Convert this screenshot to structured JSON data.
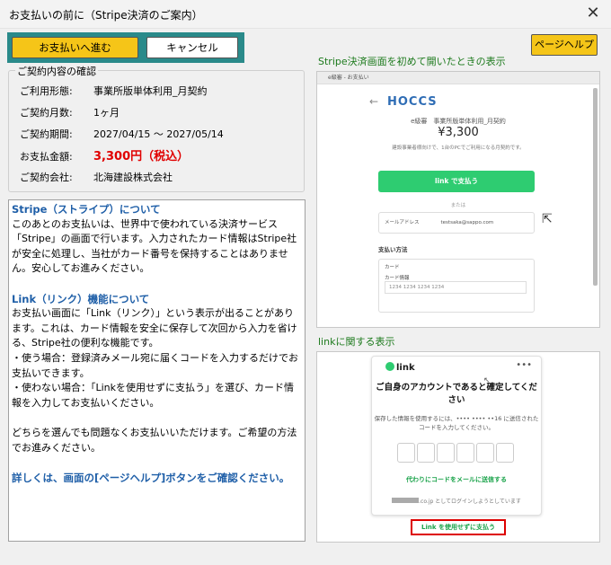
{
  "window": {
    "title": "お支払いの前に（Stripe決済のご案内）",
    "close_label": "✕"
  },
  "toolbar": {
    "proceed_label": "お支払いへ進む",
    "cancel_label": "キャンセル",
    "help_label": "ページヘルプ"
  },
  "contract": {
    "legend": "ご契約内容の確認",
    "rows": [
      {
        "label": "ご利用形態:",
        "value": "事業所版単体利用_月契約"
      },
      {
        "label": "ご契約月数:",
        "value": "1ヶ月"
      },
      {
        "label": "ご契約期間:",
        "value": "2027/04/15 ～ 2027/05/14"
      },
      {
        "label": "お支払金額:",
        "value": "3,300円（税込）"
      },
      {
        "label": "ご契約会社:",
        "value": "北海建設株式会社"
      }
    ]
  },
  "info": {
    "heading1": "Stripe（ストライプ）について",
    "para1": "このあとのお支払いは、世界中で使われている決済サービス「Stripe」の画面で行います。入力されたカード情報はStripe社が安全に処理し、当社がカード番号を保持することはありません。安心してお進みください。",
    "heading2": "Link（リンク）機能について",
    "para2": "お支払い画面に「Link（リンク）」という表示が出ることがあります。これは、カード情報を安全に保存して次回から入力を省ける、Stripe社の便利な機能です。",
    "bullet1": "・使う場合：登録済みメール宛に届くコードを入力するだけでお支払いできます。",
    "bullet2": "・使わない場合：「Linkを使用せずに支払う」を選び、カード情報を入力してお支払いください。",
    "para3": "どちらを選んでも問題なくお支払いいただけます。ご希望の方法でお進みください。",
    "footer": "詳しくは、画面の[ページヘルプ]ボタンをご確認ください。"
  },
  "stripe_preview": {
    "label": "Stripe決済画面を初めて開いたときの表示",
    "tab_text": "e級審 - お支払い",
    "logo": "HOCCS",
    "product": "e級審　事業所版単体利用_月契約",
    "price": "¥3,300",
    "note": "建設事業者様向けで、1台のPCでご利用になる月契約です。",
    "link_button": "link で支払う",
    "or_text": "または",
    "email_label": "メールアドレス",
    "email_value": "testsaka@sappo.com",
    "payment_method": "支払い方法",
    "card_label": "カード",
    "card_info_label": "カード情報",
    "card_number_placeholder": "1234 1234 1234 1234"
  },
  "link_preview": {
    "label": "linkに関する表示",
    "logo": "link",
    "menu": "•••",
    "title": "ご自身のアカウントであると確定してください",
    "desc": "保存した情報を使用するには、•••• •••• ••16 に送信されたコードを入力してください。",
    "resend": "代わりにコードをメールに送信する",
    "login_text": ".co.jp としてログインしようとしています",
    "no_link_button": "Link を使用せずに支払う"
  }
}
